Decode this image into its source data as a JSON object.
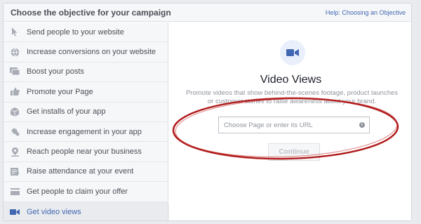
{
  "header": {
    "title": "Choose the objective for your campaign",
    "help_link": "Help: Choosing an Objective"
  },
  "sidebar": {
    "items": [
      {
        "label": "Send people to your website",
        "icon": "cursor-icon"
      },
      {
        "label": "Increase conversions on your website",
        "icon": "globe-icon"
      },
      {
        "label": "Boost your posts",
        "icon": "post-icon"
      },
      {
        "label": "Promote your Page",
        "icon": "thumbs-up-icon"
      },
      {
        "label": "Get installs of your app",
        "icon": "box-icon"
      },
      {
        "label": "Increase engagement in your app",
        "icon": "puzzle-icon"
      },
      {
        "label": "Reach people near your business",
        "icon": "location-icon"
      },
      {
        "label": "Raise attendance at your event",
        "icon": "calendar-icon"
      },
      {
        "label": "Get people to claim your offer",
        "icon": "offer-icon"
      },
      {
        "label": "Get video views",
        "icon": "video-camera-icon",
        "selected": true
      }
    ]
  },
  "main": {
    "title": "Video Views",
    "description": "Promote videos that show behind-the-scenes footage, product launches or customer stories to raise awareness about your brand.",
    "input_placeholder": "Choose Page or enter its URL",
    "continue_label": "Continue"
  },
  "colors": {
    "accent": "#4267b2",
    "annotation": "#b01c1c"
  }
}
